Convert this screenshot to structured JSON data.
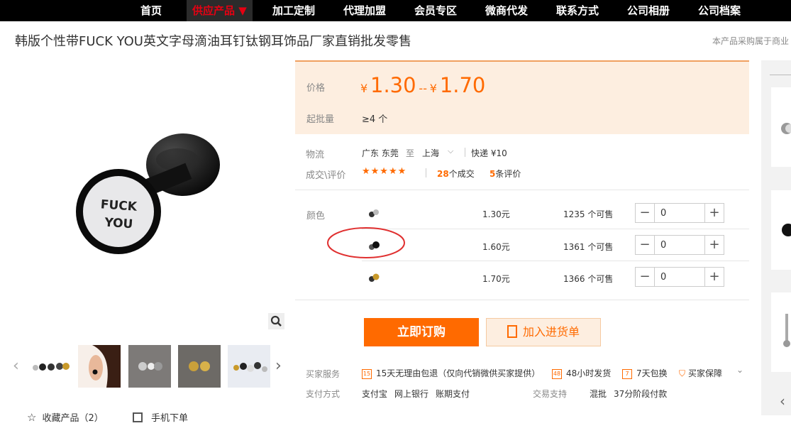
{
  "nav": {
    "items": [
      "首页",
      "供应产品 ▼",
      "加工定制",
      "代理加盟",
      "会员专区",
      "微商代发",
      "联系方式",
      "公司相册",
      "公司档案"
    ]
  },
  "product": {
    "title": "韩版个性带FUCK YOU英文字母滴油耳钉钛钢耳饰品厂家直销批发零售",
    "purchase_note": "本产品采购属于商业"
  },
  "image": {
    "earring_text": "FUCK YOU"
  },
  "actions": {
    "favorite_label": "收藏产品（2）",
    "mobile_label": "手机下单"
  },
  "price": {
    "label": "价格",
    "currency": "¥",
    "low": "1.30",
    "separator": "--",
    "high": "1.70",
    "moq_label": "起批量",
    "moq_value": "≥4 个"
  },
  "logistics": {
    "label": "物流",
    "from": "广东 东莞",
    "to_word": "至",
    "to": "上海",
    "shipping": "快递 ¥10"
  },
  "deals": {
    "label": "成交\\评价",
    "stars": "★★★★★",
    "deal_count": "28",
    "deal_suffix": "个成交",
    "review_count": "5",
    "review_suffix": "条评价"
  },
  "sku": {
    "label": "颜色",
    "rows": [
      {
        "price": "1.30元",
        "stock": "1235 个可售",
        "qty": "0"
      },
      {
        "price": "1.60元",
        "stock": "1361 个可售",
        "qty": "0"
      },
      {
        "price": "1.70元",
        "stock": "1366 个可售",
        "qty": "0"
      }
    ]
  },
  "buttons": {
    "buy": "立即订购",
    "cart": "加入进货单"
  },
  "services": {
    "label": "买家服务",
    "items": [
      "15天无理由包退（仅向代销微供买家提供）",
      "48小时发货",
      "7天包换",
      "买家保障"
    ],
    "icon_texts": [
      "15",
      "48",
      "7",
      ""
    ]
  },
  "payment": {
    "label": "支付方式",
    "methods": [
      "支付宝",
      "网上银行",
      "账期支付"
    ],
    "trade_label": "交易支持",
    "trade_items": [
      "混批",
      "37分阶段付款"
    ]
  },
  "colors": {
    "accent": "#ff6a00",
    "nav_bg": "#000000",
    "nav_active": "#e60012",
    "price_panel_bg": "#fdeee0",
    "annotation_circle": "#e03030"
  }
}
